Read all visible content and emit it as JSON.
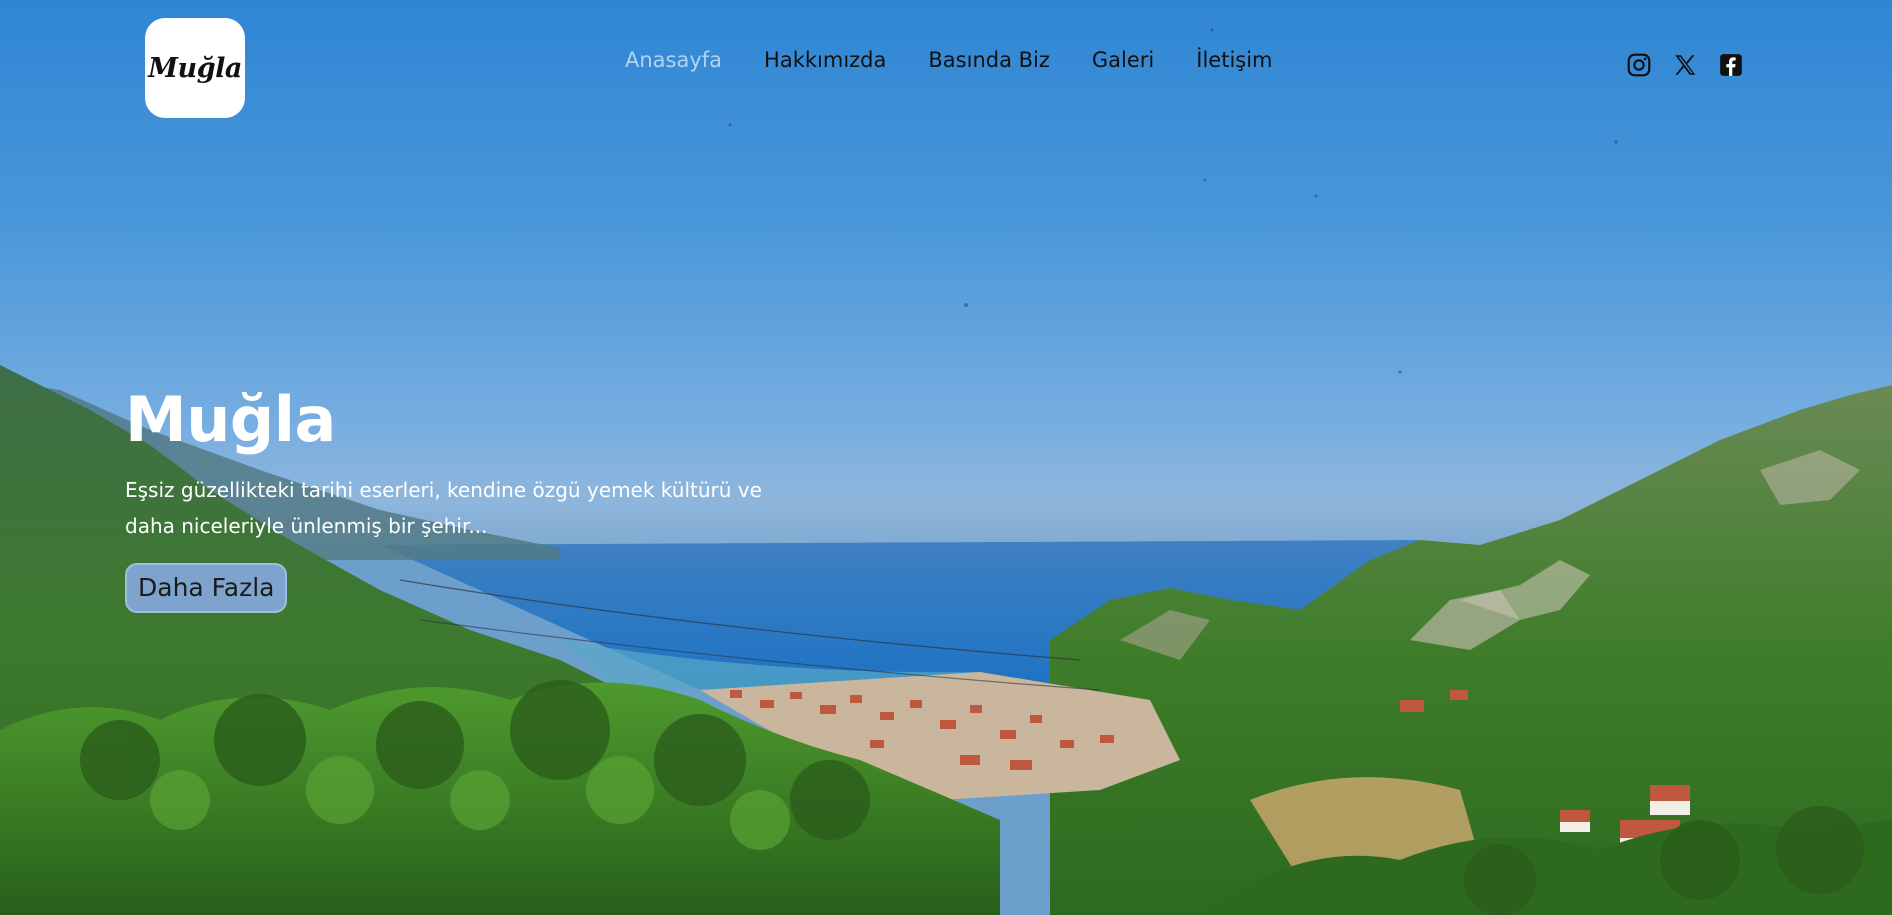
{
  "brand": {
    "logo_text": "Muğla"
  },
  "nav": {
    "items": [
      {
        "label": "Anasayfa",
        "active": true
      },
      {
        "label": "Hakkımızda",
        "active": false
      },
      {
        "label": "Basında Biz",
        "active": false
      },
      {
        "label": "Galeri",
        "active": false
      },
      {
        "label": "İletişim",
        "active": false
      }
    ]
  },
  "social": [
    {
      "icon": "instagram-icon"
    },
    {
      "icon": "x-twitter-icon"
    },
    {
      "icon": "facebook-icon"
    }
  ],
  "hero": {
    "title": "Muğla",
    "description_line1": "Eşsiz güzellikteki tarihi eserleri, kendine özgü yemek kültürü ve",
    "description_line2": "daha niceleriyle ünlenmiş bir şehir...",
    "cta_label": "Daha Fazla",
    "background": "photo of a coastal valley town between forested mountains and the sea"
  },
  "colors": {
    "sky": "#2f86d4",
    "nav_active": "#b3d2ee",
    "cta_bg": "#7ea4cd"
  }
}
